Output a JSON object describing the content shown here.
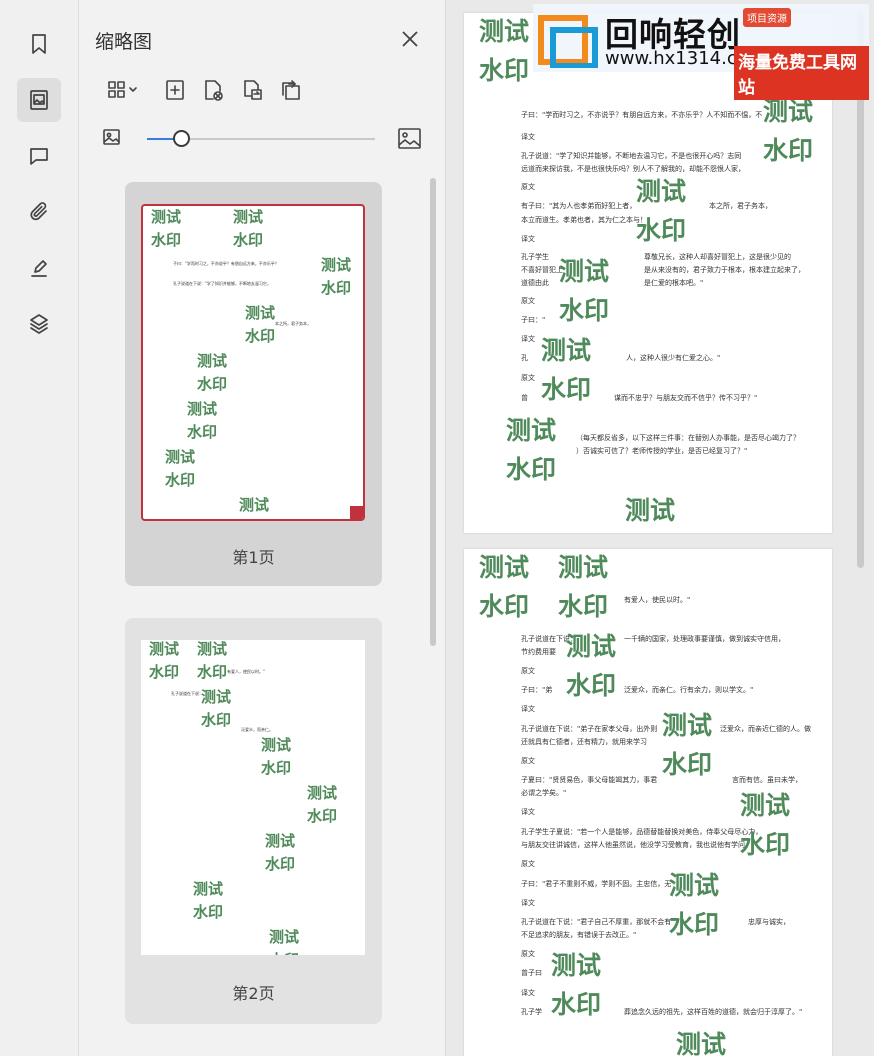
{
  "sidebar": {
    "icons": [
      "bookmark-icon",
      "thumbnail-icon",
      "comment-icon",
      "attachment-icon",
      "signature-icon",
      "layers-icon"
    ],
    "active": "thumbnail-icon"
  },
  "thumbnail_panel": {
    "title": "缩略图",
    "toolbar_icons": [
      "grid-view-icon",
      "insert-page-icon",
      "delete-page-icon",
      "replace-page-icon",
      "extract-page-icon"
    ],
    "zoom": {
      "value": 0.15
    },
    "pages": [
      {
        "label": "第1页",
        "selected": true
      },
      {
        "label": "第2页",
        "selected": false
      }
    ]
  },
  "watermark": {
    "line1": "测试",
    "line2": "水印",
    "color": "#4f8a5a"
  },
  "accent_color": "#c0323c",
  "page1": {
    "t1": "子曰：\"学而时习之，不亦说乎？有朋自远方来，不亦乐乎？人不知而不愠，不",
    "t2": "译文",
    "t3": "孔子说道：\"学了知识并能够，不断地去温习它，不是也很开心吗？志同",
    "t4": "远道而来探访我，不是也很快乐吗？别人不了解我的，却能不怨恨人家，",
    "t5": "原文",
    "t6": "有子曰：\"其为人也孝弟而好犯上者，",
    "t7": "本之所，君子务本，",
    "t8": "本立而道生。孝弟也者，其为仁之本与！\"",
    "t9": "译文",
    "t10": "孔子学生",
    "t11": "尊敬兄长，这种人却喜好冒犯上，这是很少见的",
    "t12": "不喜好冒犯上",
    "t13": "是从来没有的，君子致力于根本，根本建立起来了，",
    "t14": "道德由此",
    "t15": "是仁爱的根本吧。\"",
    "t16": "原文",
    "t17": "子曰：\"",
    "t18": "译文",
    "t19": "孔",
    "t20": "人，这种人很少有仁爱之心。\"",
    "t21": "原文",
    "t22": "曾",
    "t23": "谋而不忠乎？与朋友交而不信乎？传不习乎？\"",
    "t24": "（每天都反省多，以下这样三件事：在替别人办事能，是否尽心竭力了？",
    "t25": "）否诚实可信了？老师传授的学业，是否已经复习了？\""
  },
  "page2": {
    "t1": "有爱人，使民以时。\"",
    "t2": "孔子说道在下说：",
    "t3": "一千辆的国家，处理政事要谨慎，做到诚实守信用，",
    "t4": "节约费用要",
    "t5": "原文",
    "t6": "子曰：\"弟",
    "t7": "泛爱众，而亲仁。行有余力，则以学文。\"",
    "t8": "译文",
    "t9": "孔子说道在下说：\"弟子在家孝父母，出外则",
    "t10": "泛爱众，而亲近仁德的人。做",
    "t11": "还就具有仁德者，还有精力，就用来学习",
    "t12": "原文",
    "t13": "子夏曰：\"贤贤易色，事父母能竭其力，事君",
    "t14": "言而有信。虽曰未学，",
    "t15": "必谓之学矣。\"",
    "t16": "译文",
    "t17": "孔子学生子夏说：\"若一个人是能够，品德替能替换对美色，侍奉父母尽心力，",
    "t18": "与朋友交往讲诚信，这样人他虽然说，他没学习受教育，我也说他有学问。",
    "t19": "原文",
    "t20": "子曰：\"君子不重则不威，学则不固。主忠信，无",
    "t21": "译文",
    "t22": "孔子说道在下说：\"君子自己不厚重，那就不会有",
    "t23": "忠厚与诚实，",
    "t24": "不足追求的朋友，有错误于去改正。\"",
    "t25": "原文",
    "t26": "曾子曰",
    "t27": "译文",
    "t28": "孔子学",
    "t29": "葬追念久远的祖先，这样百姓的道德，就会归于淳厚了。\""
  },
  "thumb1_text": [
    "子曰：\"学而时习之，不亦说乎？有朋自远方来，不亦乐乎？",
    "孔子说道在下说：\"学了知识并能够，不断地去温习它，",
    "本之所，君子务本，"
  ],
  "thumb2_text": [
    "有爱人，使民以时。\"",
    "孔子说道在下说：",
    "泛爱众，而亲仁。"
  ],
  "banner": {
    "brand": "回响轻创",
    "url": "www.hx1314.cc",
    "badge": "项目资源",
    "tagline": "海量免费工具网站"
  }
}
